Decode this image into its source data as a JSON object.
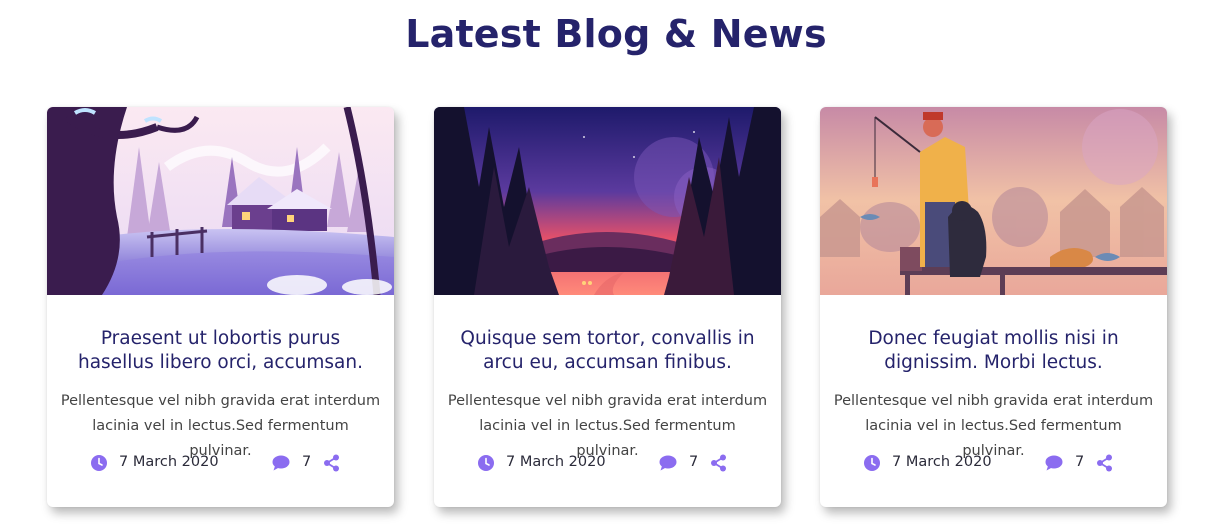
{
  "section": {
    "title": "Latest Blog & News"
  },
  "colors": {
    "heading": "#25236b",
    "accent": "#8b6cf0",
    "text": "#444444"
  },
  "cards": [
    {
      "image_name": "winter-cabin-illustration",
      "title": "Praesent ut lobortis purus hasellus libero orci, accumsan.",
      "excerpt": "Pellentesque vel nibh gravida erat interdum lacinia vel in lectus.Sed fermentum pulvinar.",
      "date": "7 March 2020",
      "comments": "7",
      "icons": [
        "clock-icon",
        "comment-icon",
        "share-icon"
      ]
    },
    {
      "image_name": "forest-sunset-illustration",
      "title": "Quisque sem tortor, convallis in arcu eu, accumsan finibus.",
      "excerpt": "Pellentesque vel nibh gravida erat interdum lacinia vel in lectus.Sed fermentum pulvinar.",
      "date": "7 March 2020",
      "comments": "7",
      "icons": [
        "clock-icon",
        "comment-icon",
        "share-icon"
      ]
    },
    {
      "image_name": "fisherman-dog-illustration",
      "title": "Donec feugiat mollis nisi in dignissim. Morbi lectus.",
      "excerpt": "Pellentesque vel nibh gravida erat interdum lacinia vel in lectus.Sed fermentum pulvinar.",
      "date": "7 March 2020",
      "comments": "7",
      "icons": [
        "clock-icon",
        "comment-icon",
        "share-icon"
      ]
    }
  ]
}
